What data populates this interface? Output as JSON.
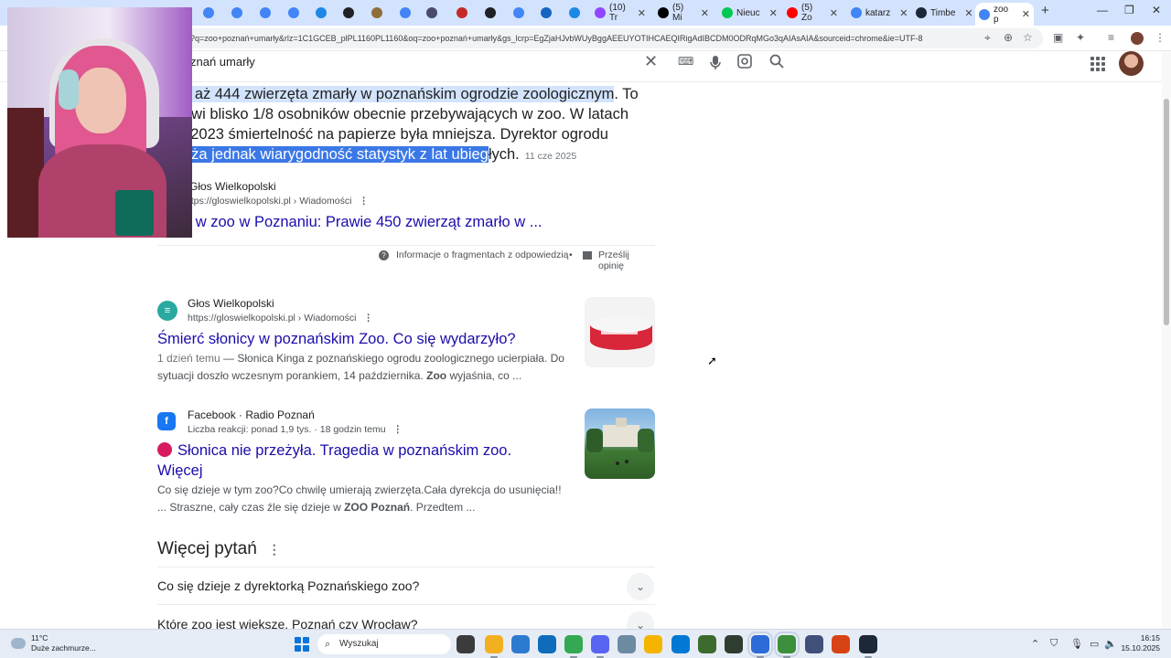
{
  "browser": {
    "tabs": [
      {
        "title": "",
        "color": "#4285f4"
      },
      {
        "title": "",
        "color": "#4285f4"
      },
      {
        "title": "",
        "color": "#4285f4"
      },
      {
        "title": "",
        "color": "#4285f4"
      },
      {
        "title": "",
        "color": "#1e88e5"
      },
      {
        "title": "",
        "color": "#202124"
      },
      {
        "title": "",
        "color": "#8e6e3c"
      },
      {
        "title": "",
        "color": "#4285f4"
      },
      {
        "title": "",
        "color": "#4a4a6a"
      },
      {
        "title": "",
        "color": "#c62828"
      },
      {
        "title": "",
        "color": "#202124"
      },
      {
        "title": "",
        "color": "#4285f4"
      },
      {
        "title": "",
        "color": "#1565c0"
      },
      {
        "title": "",
        "color": "#1e88e5"
      },
      {
        "title": "(10) Tr",
        "color": "#9146ff"
      },
      {
        "title": "(5) Mi",
        "color": "#000000"
      },
      {
        "title": "Nieuc",
        "color": "#00c853"
      },
      {
        "title": "(5) Zo",
        "color": "#ff0000"
      },
      {
        "title": "katarz",
        "color": "#4285f4"
      },
      {
        "title": "Timbe",
        "color": "#1b2838"
      },
      {
        "title": "zoo p",
        "color": "#4285f4"
      }
    ],
    "new_tab": "+",
    "window_controls": [
      "—",
      "❐",
      "✕"
    ],
    "url": "?q=zoo+poznań+umarły&rlz=1C1GCEB_plPL1160PL1160&oq=zoo+poznań+umarły&gs_lcrp=EgZjaHJvbWUyBggAEEUYOTIHCAEQIRigAdIBCDM0ODRqMGo3qAIAsAIA&sourceid=chrome&ie=UTF-8"
  },
  "search": {
    "query": "znań umarły"
  },
  "snippet": {
    "line1_highlighted": "k aż 444 zwierzęta zmarły w poznańskim ogrodzie zoologicznym",
    "line1_tail": ". To",
    "line2": "owi blisko 1/8 osobników obecnie przebywających w zoo. W latach",
    "line3": "i 2023 śmiertelność na papierze była mniejsza. Dyrektor ogrodu",
    "line4_selected": "aża jednak wiarygodność statystyk z lat ubieg",
    "line4_tail": "łych.",
    "date": "11 cze 2025",
    "source_name": "Głos Wielkopolski",
    "source_url": "https://gloswielkopolski.pl › Wiadomości",
    "link_title": "n w zoo w Poznaniu: Prawie 450 zwierząt zmarło w ..."
  },
  "feedback": {
    "info": "Informacje o fragmentach z odpowiedzią",
    "send": "Prześlij opinię"
  },
  "results": [
    {
      "source": "Głos Wielkopolski",
      "url": "https://gloswielkopolski.pl › Wiadomości",
      "title": "Śmierć słonicy w poznańskim Zoo. Co się wydarzyło?",
      "meta": "1 dzień temu",
      "desc_a": " — Słonica Kinga z poznańskiego ogrodu zoologicznego ucierpiała. Do sytuacji doszło wczesnym porankiem, 14 października. ",
      "desc_bold": "Zoo",
      "desc_b": " wyjaśnia, co ..."
    },
    {
      "source": "Facebook · Radio Poznań",
      "url": "Liczba reakcji: ponad 1,9 tys. · 18 godzin temu",
      "title_line1": "Słonica nie przeżyła. Tragedia w poznańskim zoo.",
      "title_line2": "Więcej",
      "desc_a": "Co się dzieje w tym zoo?Co chwilę umierają zwierzęta.Cała dyrekcja do usunięcia!! ... Straszne, cały czas źle się dzieje w ",
      "desc_bold": "ZOO Poznań",
      "desc_b": ". Przedtem ..."
    }
  ],
  "more_questions": {
    "title": "Więcej pytań",
    "items": [
      "Co się dzieje z dyrektorką Poznańskiego zoo?",
      "Które zoo jest większe, Poznań czy Wrocław?"
    ]
  },
  "taskbar": {
    "temperature": "11°C",
    "weather": "Duże zachmurze...",
    "search_placeholder": "Wyszukaj",
    "time": "16:15",
    "date": "15.10.2025"
  }
}
